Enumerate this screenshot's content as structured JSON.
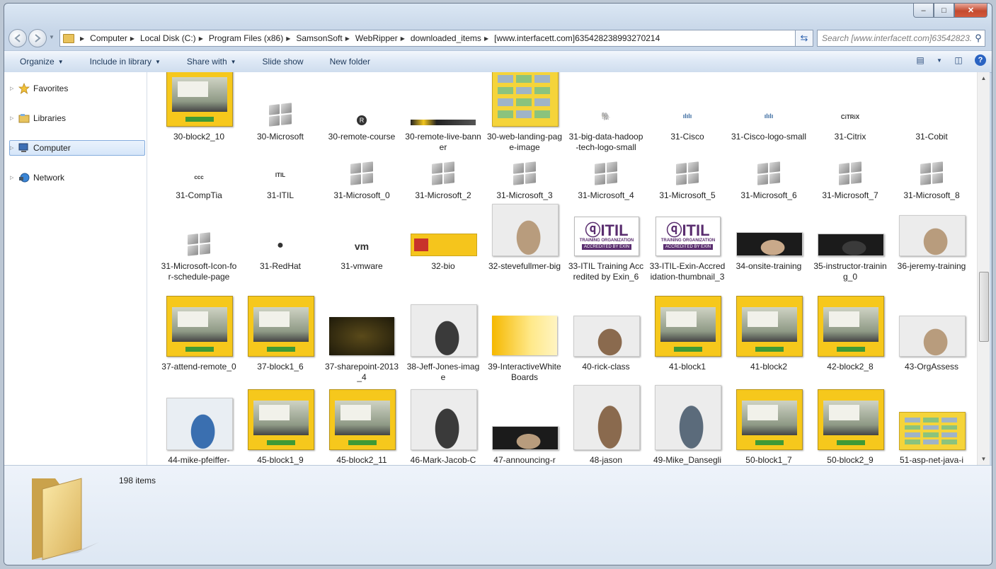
{
  "window": {
    "caption_buttons": {
      "minimize": "–",
      "maximize": "□",
      "close": "✕"
    }
  },
  "address_bar": {
    "crumbs": [
      "Computer",
      "Local Disk (C:)",
      "Program Files (x86)",
      "SamsonSoft",
      "WebRipper",
      "downloaded_items",
      "[www.interfacett.com]635428238993270214"
    ],
    "search_placeholder": "Search [www.interfacett.com]63542823..."
  },
  "toolbar": {
    "organize": "Organize",
    "include_in_library": "Include in library",
    "share_with": "Share with",
    "slide_show": "Slide show",
    "new_folder": "New folder"
  },
  "nav_pane": {
    "items": [
      {
        "label": "Favorites",
        "icon": "star-icon"
      },
      {
        "label": "Libraries",
        "icon": "library-icon"
      },
      {
        "label": "Computer",
        "icon": "computer-icon",
        "selected": true
      },
      {
        "label": "Network",
        "icon": "network-icon"
      }
    ]
  },
  "files": {
    "rows": [
      [
        {
          "name": "30-block2_10",
          "thumb": "yellow-promo"
        },
        {
          "name": "30-Microsoft",
          "thumb": "windows-logo"
        },
        {
          "name": "30-remote-course",
          "thumb": "registered-mark"
        },
        {
          "name": "30-remote-live-banner",
          "thumb": "banner"
        },
        {
          "name": "30-web-landing-page-image",
          "thumb": "yellow-grid"
        },
        {
          "name": "31-big-data-hadoop-tech-logo-small",
          "thumb": "hadoop-logo"
        },
        {
          "name": "31-Cisco",
          "thumb": "cisco-logo"
        },
        {
          "name": "31-Cisco-logo-small",
          "thumb": "cisco-logo"
        },
        {
          "name": "31-Citrix",
          "thumb": "citrix-logo"
        },
        {
          "name": "31-Cobit",
          "thumb": "cobit-logo"
        }
      ],
      [
        {
          "name": "31-CompTia",
          "thumb": "comptia-logo"
        },
        {
          "name": "31-ITIL",
          "thumb": "itil-logo"
        },
        {
          "name": "31-Microsoft_0",
          "thumb": "windows-logo"
        },
        {
          "name": "31-Microsoft_2",
          "thumb": "windows-logo"
        },
        {
          "name": "31-Microsoft_3",
          "thumb": "windows-logo"
        },
        {
          "name": "31-Microsoft_4",
          "thumb": "windows-logo"
        },
        {
          "name": "31-Microsoft_5",
          "thumb": "windows-logo"
        },
        {
          "name": "31-Microsoft_6",
          "thumb": "windows-logo"
        },
        {
          "name": "31-Microsoft_7",
          "thumb": "windows-logo"
        },
        {
          "name": "31-Microsoft_8",
          "thumb": "windows-logo"
        }
      ],
      [
        {
          "name": "31-Microsoft-Icon-for-schedule-page",
          "thumb": "windows-logo"
        },
        {
          "name": "31-RedHat",
          "thumb": "redhat-logo"
        },
        {
          "name": "31-vmware",
          "thumb": "vmware-logo"
        },
        {
          "name": "32-bio",
          "thumb": "bio-banner"
        },
        {
          "name": "32-stevefullmer-big",
          "thumb": "photo"
        },
        {
          "name": "33-ITIL Training Accredited by Exin_6",
          "thumb": "itil-badge"
        },
        {
          "name": "33-ITIL-Exin-Accredidation-thumbnail_3",
          "thumb": "itil-badge"
        },
        {
          "name": "34-onsite-training",
          "thumb": "photo-dark"
        },
        {
          "name": "35-instructor-training_0",
          "thumb": "photo-dark"
        },
        {
          "name": "36-jeremy-training",
          "thumb": "photo"
        }
      ],
      [
        {
          "name": "37-attend-remote_0",
          "thumb": "yellow-promo"
        },
        {
          "name": "37-block1_6",
          "thumb": "yellow-promo"
        },
        {
          "name": "37-sharepoint-2013_4",
          "thumb": "sharepoint"
        },
        {
          "name": "38-Jeff-Jones-image",
          "thumb": "photo"
        },
        {
          "name": "39-InteractiveWhiteBoards",
          "thumb": "yellow-room"
        },
        {
          "name": "40-rick-class",
          "thumb": "photo"
        },
        {
          "name": "41-block1",
          "thumb": "yellow-promo"
        },
        {
          "name": "41-block2",
          "thumb": "yellow-promo"
        },
        {
          "name": "42-block2_8",
          "thumb": "yellow-promo"
        },
        {
          "name": "43-OrgAssess",
          "thumb": "photo"
        }
      ],
      [
        {
          "name": "44-mike-pfeiffer-",
          "thumb": "photo-blue"
        },
        {
          "name": "45-block1_9",
          "thumb": "yellow-promo"
        },
        {
          "name": "45-block2_11",
          "thumb": "yellow-promo"
        },
        {
          "name": "46-Mark-Jacob-C",
          "thumb": "photo"
        },
        {
          "name": "47-announcing-r",
          "thumb": "photo-dark"
        },
        {
          "name": "48-jason",
          "thumb": "photo"
        },
        {
          "name": "49-Mike_Dansegli",
          "thumb": "photo"
        },
        {
          "name": "50-block1_7",
          "thumb": "yellow-promo"
        },
        {
          "name": "50-block2_9",
          "thumb": "yellow-promo"
        },
        {
          "name": "51-asp-net-java-i",
          "thumb": "yellow-grid"
        }
      ]
    ]
  },
  "status": {
    "item_count": "198 items"
  }
}
